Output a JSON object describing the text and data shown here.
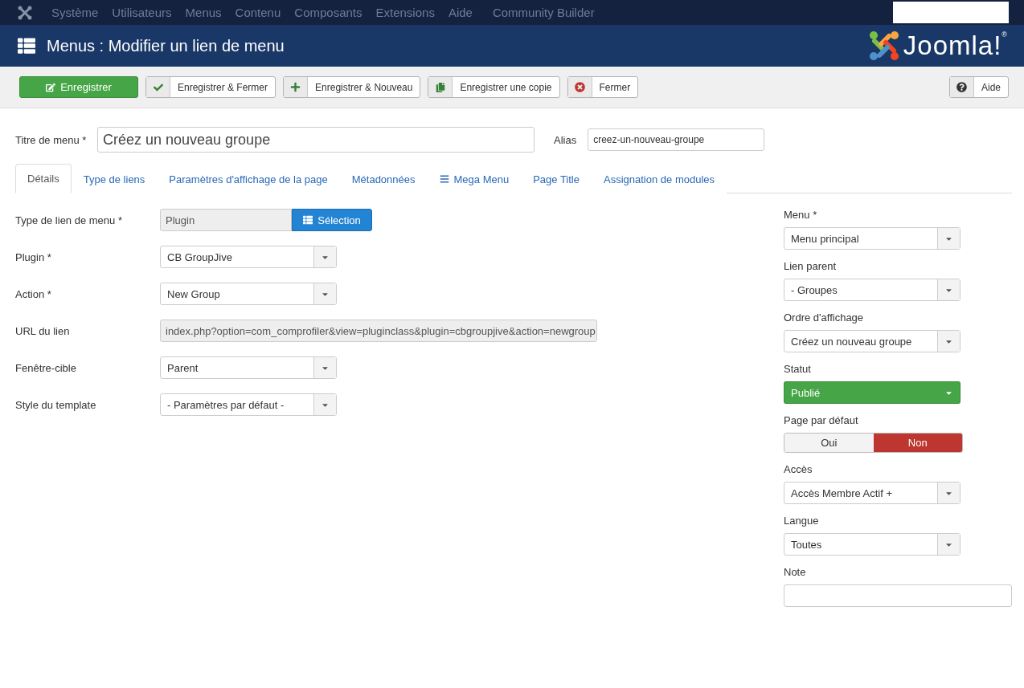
{
  "top_menu": {
    "items": [
      "Système",
      "Utilisateurs",
      "Menus",
      "Contenu",
      "Composants",
      "Extensions",
      "Aide",
      "Community Builder"
    ]
  },
  "header": {
    "title": "Menus : Modifier un lien de menu",
    "logo_text": "Joomla!$^{®}$"
  },
  "toolbar": {
    "buttons": [
      {
        "kind": "save",
        "label": "Enregistrer"
      },
      {
        "kind": "save_close",
        "label": "Enregistrer & Fermer"
      },
      {
        "kind": "save_new",
        "label": "Enregistrer & Nouveau"
      },
      {
        "kind": "copy",
        "label": "Enregistrer une copie"
      },
      {
        "kind": "close",
        "label": "Fermer"
      }
    ],
    "help": {
      "kind": "help",
      "label": "Aide"
    }
  },
  "title_field": {
    "label": "Titre de menu *",
    "value": "Créez un nouveau groupe"
  },
  "alias_field": {
    "label": "Alias",
    "value": "creez-un-nouveau-groupe"
  },
  "tabs": [
    {
      "label": "Détails",
      "selected": true,
      "kind": "plain"
    },
    {
      "label": "Type de liens",
      "selected": false,
      "kind": "plain"
    },
    {
      "label": "Paramètres d'affichage de la page",
      "selected": false,
      "kind": "plain"
    },
    {
      "label": "Métadonnées",
      "selected": false,
      "kind": "plain"
    },
    {
      "label": "Mega Menu",
      "selected": false,
      "kind": "menu"
    },
    {
      "label": "Page Title",
      "selected": false,
      "kind": "plain"
    },
    {
      "label": "Assignation de modules",
      "selected": false,
      "kind": "plain"
    }
  ],
  "details_fields": [
    {
      "kind": "picker",
      "label": "Type de lien de menu *",
      "value": "Plugin",
      "button": "Sélection"
    },
    {
      "kind": "select",
      "label": "Plugin *",
      "value": "CB GroupJive"
    },
    {
      "kind": "select",
      "label": "Action *",
      "value": "New Group"
    },
    {
      "kind": "readonly",
      "label": "URL du lien",
      "value": "index.php?option=com_comprofiler&view=pluginclass&plugin=cbgroupjive&action=newgroup"
    },
    {
      "kind": "select",
      "label": "Fenêtre-cible",
      "value": "Parent"
    },
    {
      "kind": "select",
      "label": "Style du template",
      "value": "- Paramètres par défaut -"
    }
  ],
  "side_fields": [
    {
      "kind": "select",
      "label": "Menu *",
      "value": "Menu principal"
    },
    {
      "kind": "select",
      "label": "Lien parent",
      "value": "- Groupes"
    },
    {
      "kind": "select",
      "label": "Ordre d'affichage",
      "value": "Créez un nouveau groupe"
    },
    {
      "kind": "status",
      "label": "Statut",
      "value": "Publié",
      "color": "#46a546"
    },
    {
      "kind": "toggle",
      "label": "Page par défaut",
      "options": [
        {
          "label": "Oui",
          "selected": false
        },
        {
          "label": "Non",
          "selected": true
        }
      ]
    },
    {
      "kind": "select",
      "label": "Accès",
      "value": "Accès Membre Actif +"
    },
    {
      "kind": "select",
      "label": "Langue",
      "value": "Toutes"
    },
    {
      "kind": "text",
      "label": "Note"
    }
  ]
}
